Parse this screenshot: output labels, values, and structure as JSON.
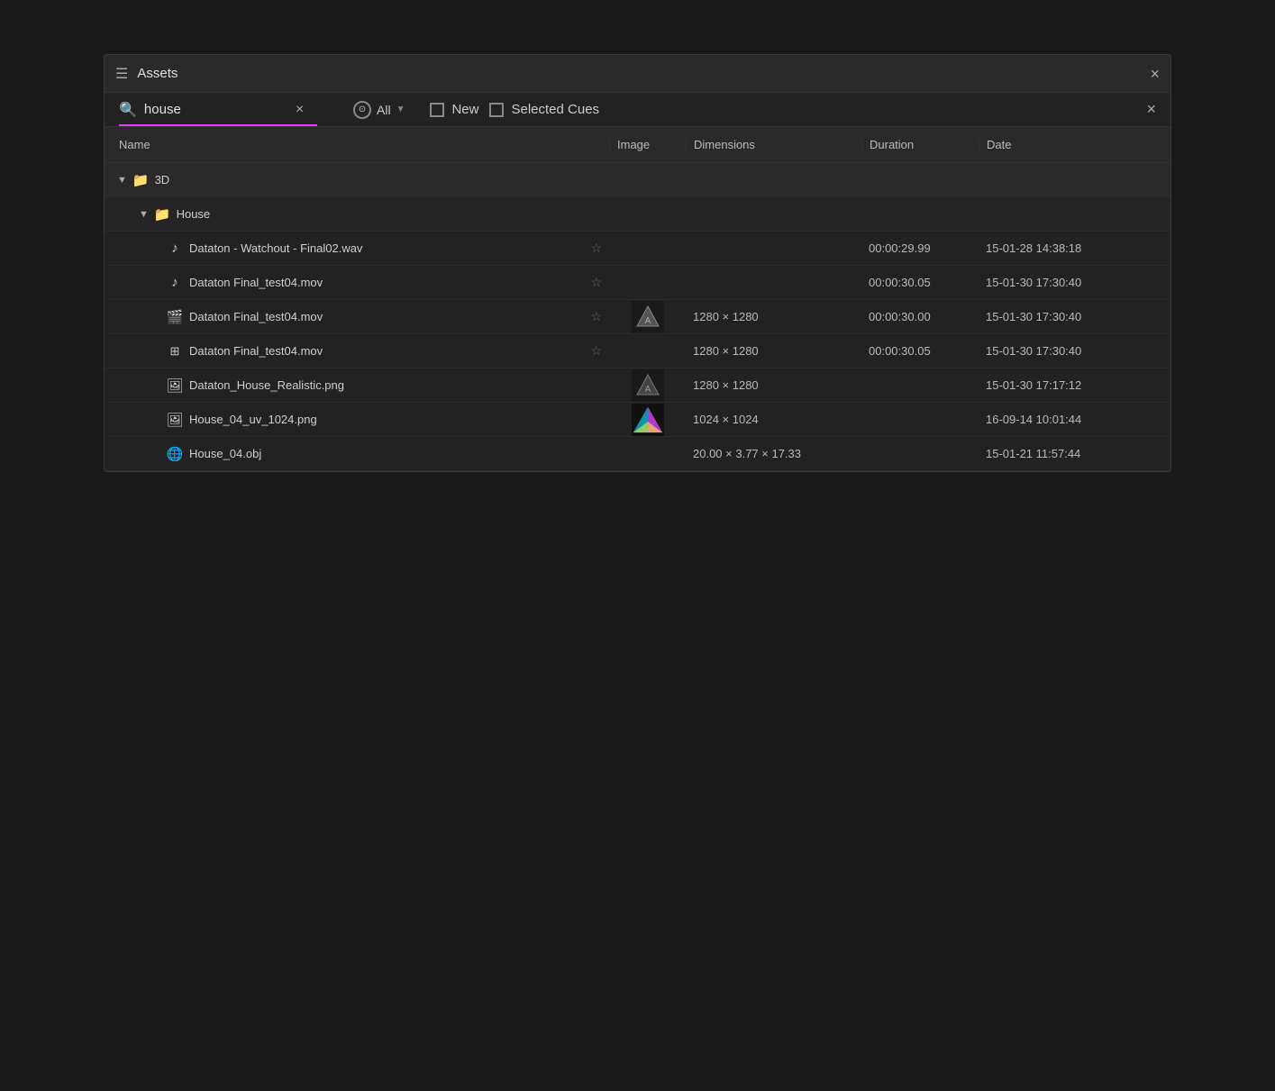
{
  "window": {
    "title": "Assets",
    "close_label": "×"
  },
  "toolbar": {
    "menu_icon": "☰",
    "search_value": "house",
    "search_placeholder": "Search...",
    "clear_label": "×",
    "filter_label": "All",
    "new_label": "New",
    "selected_cues_label": "Selected Cues"
  },
  "columns": {
    "name": "Name",
    "image": "Image",
    "dimensions": "Dimensions",
    "duration": "Duration",
    "date": "Date"
  },
  "tree": {
    "folder_3d": {
      "name": "3D",
      "children": {
        "folder_house": {
          "name": "House",
          "items": [
            {
              "icon": "audio",
              "name": "Dataton - Watchout - Final02.wav",
              "has_star": true,
              "image": null,
              "dimensions": "",
              "duration": "00:00:29.99",
              "date": "15-01-28 14:38:18"
            },
            {
              "icon": "audio",
              "name": "Dataton Final_test04.mov",
              "has_star": true,
              "image": null,
              "dimensions": "",
              "duration": "00:00:30.05",
              "date": "15-01-30 17:30:40"
            },
            {
              "icon": "video",
              "name": "Dataton Final_test04.mov",
              "has_star": true,
              "image": "dark_triangle",
              "dimensions": "1280 × 1280",
              "duration": "00:00:30.00",
              "date": "15-01-30 17:30:40"
            },
            {
              "icon": "subtitle",
              "name": "Dataton Final_test04.mov",
              "has_star": true,
              "image": null,
              "dimensions": "1280 × 1280",
              "duration": "00:00:30.05",
              "date": "15-01-30 17:30:40"
            },
            {
              "icon": "image",
              "name": "Dataton_House_Realistic.png",
              "has_star": false,
              "image": "dark_triangle",
              "dimensions": "1280 × 1280",
              "duration": "",
              "date": "15-01-30 17:17:12"
            },
            {
              "icon": "image",
              "name": "House_04_uv_1024.png",
              "has_star": false,
              "image": "colorful_triangle",
              "dimensions": "1024 × 1024",
              "duration": "",
              "date": "16-09-14 10:01:44"
            },
            {
              "icon": "globe",
              "name": "House_04.obj",
              "has_star": false,
              "image": null,
              "dimensions": "20.00 × 3.77 × 17.33",
              "duration": "",
              "date": "15-01-21 11:57:44"
            }
          ]
        }
      }
    }
  }
}
